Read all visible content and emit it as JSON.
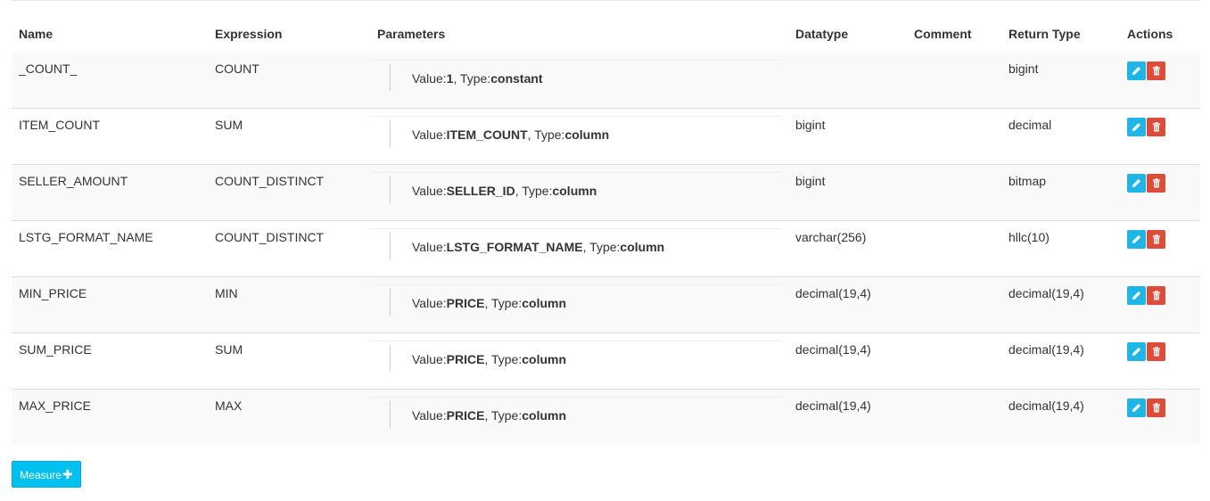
{
  "table": {
    "headers": {
      "name": "Name",
      "expression": "Expression",
      "parameters": "Parameters",
      "datatype": "Datatype",
      "comment": "Comment",
      "return_type": "Return Type",
      "actions": "Actions"
    },
    "rows": [
      {
        "name": "_COUNT_",
        "expression": "COUNT",
        "param_value_label": "Value:",
        "param_value": "1",
        "param_type_label": ", Type:",
        "param_type": "constant",
        "datatype": "",
        "comment": "",
        "return_type": "bigint"
      },
      {
        "name": "ITEM_COUNT",
        "expression": "SUM",
        "param_value_label": "Value:",
        "param_value": "ITEM_COUNT",
        "param_type_label": ", Type:",
        "param_type": "column",
        "datatype": "bigint",
        "comment": "",
        "return_type": "decimal"
      },
      {
        "name": "SELLER_AMOUNT",
        "expression": "COUNT_DISTINCT",
        "param_value_label": "Value:",
        "param_value": "SELLER_ID",
        "param_type_label": ", Type:",
        "param_type": "column",
        "datatype": "bigint",
        "comment": "",
        "return_type": "bitmap"
      },
      {
        "name": "LSTG_FORMAT_NAME",
        "expression": "COUNT_DISTINCT",
        "param_value_label": "Value:",
        "param_value": "LSTG_FORMAT_NAME",
        "param_type_label": ", Type:",
        "param_type": "column",
        "datatype": "varchar(256)",
        "comment": "",
        "return_type": "hllc(10)"
      },
      {
        "name": "MIN_PRICE",
        "expression": "MIN",
        "param_value_label": "Value:",
        "param_value": "PRICE",
        "param_type_label": ", Type:",
        "param_type": "column",
        "datatype": "decimal(19,4)",
        "comment": "",
        "return_type": "decimal(19,4)"
      },
      {
        "name": "SUM_PRICE",
        "expression": "SUM",
        "param_value_label": "Value:",
        "param_value": "PRICE",
        "param_type_label": ", Type:",
        "param_type": "column",
        "datatype": "decimal(19,4)",
        "comment": "",
        "return_type": "decimal(19,4)"
      },
      {
        "name": "MAX_PRICE",
        "expression": "MAX",
        "param_value_label": "Value:",
        "param_value": "PRICE",
        "param_type_label": ", Type:",
        "param_type": "column",
        "datatype": "decimal(19,4)",
        "comment": "",
        "return_type": "decimal(19,4)"
      }
    ],
    "actions": {
      "edit_icon": "pencil-icon",
      "delete_icon": "trash-icon"
    }
  },
  "add_button": {
    "label": "Measure",
    "icon": "plus-icon"
  },
  "colors": {
    "edit_button": "#1fb6e7",
    "delete_button": "#dd4b39",
    "add_button": "#00c0ef",
    "row_stripe": "#f9f9f9"
  }
}
